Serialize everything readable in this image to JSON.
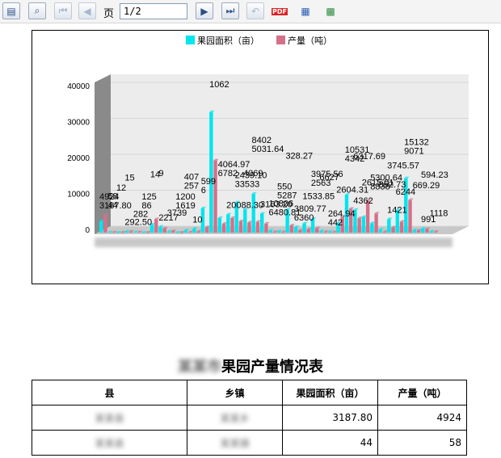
{
  "toolbar": {
    "page_label": "页",
    "page_value": "1/2",
    "pdf_label": "PDF",
    "buttons": [
      "toc-icon",
      "find-icon",
      "first-page-icon",
      "prev-page-icon",
      "next-page-icon",
      "last-page-icon",
      "back-icon",
      "export-pdf-icon",
      "export-word-icon",
      "export-excel-icon"
    ]
  },
  "chart_data": {
    "type": "bar",
    "style": "3d-grouped",
    "legend_position": "top",
    "grid": true,
    "ylim": [
      0,
      40000
    ],
    "yticks": [
      "40000",
      "30000",
      "20000",
      "10000",
      "0"
    ],
    "categories_blurred": true,
    "series": [
      {
        "name": "果园面积（亩）",
        "color": "#00e5ee",
        "values": [
          3187.8,
          44,
          12,
          292.5,
          86,
          14,
          2217,
          1619,
          257,
          10,
          599,
          1062,
          6782,
          33533,
          4064.97,
          5031.64,
          8402,
          6480.81,
          10806,
          5287,
          550,
          328.27,
          6360,
          1533.85,
          2563,
          3809.77,
          442,
          264.94,
          2604.31,
          10531,
          6317.69,
          4362,
          2615.01,
          852.73,
          3745.57,
          6244,
          15132,
          669.29,
          1118,
          300
        ]
      },
      {
        "name": "产量（吨）",
        "color": "#d4708a",
        "values": [
          4924,
          58,
          15,
          282,
          125,
          9,
          3739,
          1200,
          407,
          6,
          100,
          300,
          1500,
          20088.3,
          2439.1,
          4069,
          3163.2,
          2800,
          3000,
          2500,
          200,
          150,
          2000,
          600,
          900,
          1200,
          200,
          100,
          4342,
          6627,
          3975.56,
          8838,
          5300.64,
          200,
          1421,
          3000,
          9071,
          594.23,
          991,
          200
        ]
      }
    ],
    "labels": [
      "3187.80",
      "4924",
      "44",
      "58",
      "12",
      "15",
      "292.50",
      "282",
      "86",
      "125",
      "14",
      "9",
      "2217",
      "3739",
      "1619",
      "1200",
      "257",
      "407",
      "10",
      "6",
      "599",
      "1062",
      "6782",
      "4064.97",
      "20088.30",
      "33533",
      "2439.10",
      "4069",
      "5031.64",
      "8402",
      "3163.20",
      "6480.81",
      "10806",
      "5287",
      "550",
      "328.27",
      "6360",
      "3809.77",
      "1533.85",
      "2563",
      "3975.56",
      "6627",
      "442",
      "264.94",
      "2604.31",
      "4342",
      "10531",
      "6317.69",
      "4362",
      "2615.01",
      "8838",
      "5300.64",
      "852.73",
      "3745.57",
      "1421",
      "6244",
      "9071",
      "15132",
      "669.29",
      "594.23",
      "991",
      "1118"
    ]
  },
  "report": {
    "title": "果园产量情况表",
    "title_prefix_blurred": "某某市",
    "columns": [
      "县",
      "乡镇",
      "果园面积（亩）",
      "产量（吨）"
    ],
    "rows": [
      {
        "county": "某某县",
        "town": "某某乡",
        "area": "3187.80",
        "output": "4924"
      },
      {
        "county": "某某县",
        "town": "某某镇",
        "area": "44",
        "output": "58"
      }
    ]
  }
}
